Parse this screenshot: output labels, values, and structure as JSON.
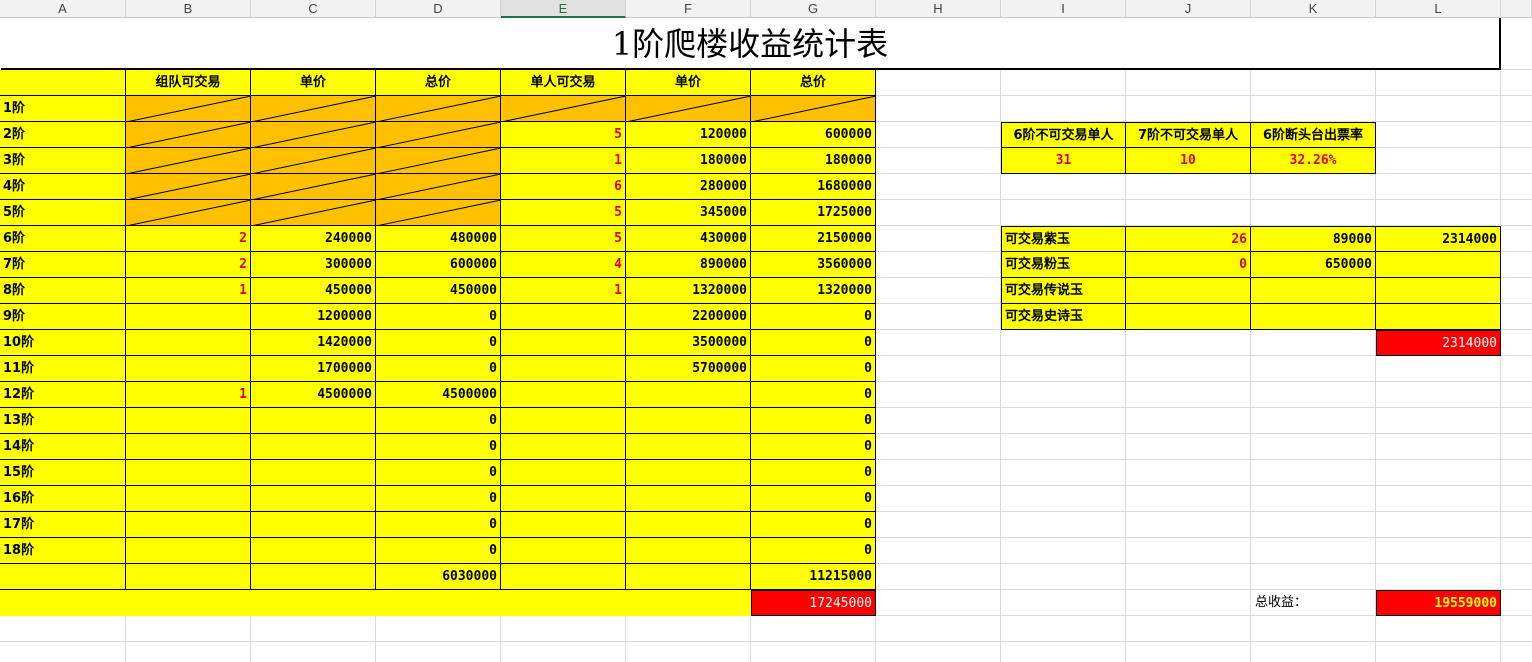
{
  "columns": [
    "A",
    "B",
    "C",
    "D",
    "E",
    "F",
    "G",
    "H",
    "I",
    "J",
    "K",
    "L"
  ],
  "selected_column": "E",
  "title": "1阶爬楼收益统计表",
  "main_table": {
    "headers": [
      "",
      "组队可交易",
      "单价",
      "总价",
      "单人可交易",
      "单价",
      "总价"
    ],
    "rows": [
      {
        "label": "1阶",
        "b": "",
        "c": "",
        "d": "",
        "e": "",
        "f": "",
        "g": "",
        "slashed": [
          1,
          2,
          3,
          4,
          5,
          6
        ]
      },
      {
        "label": "2阶",
        "b": "",
        "c": "",
        "d": "",
        "e": "5",
        "f": "120000",
        "g": "600000",
        "slashed": [
          1,
          2,
          3
        ]
      },
      {
        "label": "3阶",
        "b": "",
        "c": "",
        "d": "",
        "e": "1",
        "f": "180000",
        "g": "180000",
        "slashed": [
          1,
          2,
          3
        ]
      },
      {
        "label": "4阶",
        "b": "",
        "c": "",
        "d": "",
        "e": "6",
        "f": "280000",
        "g": "1680000",
        "slashed": [
          1,
          2,
          3
        ]
      },
      {
        "label": "5阶",
        "b": "",
        "c": "",
        "d": "",
        "e": "5",
        "f": "345000",
        "g": "1725000",
        "slashed": [
          1,
          2,
          3
        ]
      },
      {
        "label": "6阶",
        "b": "2",
        "c": "240000",
        "d": "480000",
        "e": "5",
        "f": "430000",
        "g": "2150000",
        "slashed": []
      },
      {
        "label": "7阶",
        "b": "2",
        "c": "300000",
        "d": "600000",
        "e": "4",
        "f": "890000",
        "g": "3560000",
        "slashed": []
      },
      {
        "label": "8阶",
        "b": "1",
        "c": "450000",
        "d": "450000",
        "e": "1",
        "f": "1320000",
        "g": "1320000",
        "slashed": []
      },
      {
        "label": "9阶",
        "b": "",
        "c": "1200000",
        "d": "0",
        "e": "",
        "f": "2200000",
        "g": "0",
        "slashed": []
      },
      {
        "label": "10阶",
        "b": "",
        "c": "1420000",
        "d": "0",
        "e": "",
        "f": "3500000",
        "g": "0",
        "slashed": []
      },
      {
        "label": "11阶",
        "b": "",
        "c": "1700000",
        "d": "0",
        "e": "",
        "f": "5700000",
        "g": "0",
        "slashed": []
      },
      {
        "label": "12阶",
        "b": "1",
        "c": "4500000",
        "d": "4500000",
        "e": "",
        "f": "",
        "g": "0",
        "slashed": []
      },
      {
        "label": "13阶",
        "b": "",
        "c": "",
        "d": "0",
        "e": "",
        "f": "",
        "g": "0",
        "slashed": []
      },
      {
        "label": "14阶",
        "b": "",
        "c": "",
        "d": "0",
        "e": "",
        "f": "",
        "g": "0",
        "slashed": []
      },
      {
        "label": "15阶",
        "b": "",
        "c": "",
        "d": "0",
        "e": "",
        "f": "",
        "g": "0",
        "slashed": []
      },
      {
        "label": "16阶",
        "b": "",
        "c": "",
        "d": "0",
        "e": "",
        "f": "",
        "g": "0",
        "slashed": []
      },
      {
        "label": "17阶",
        "b": "",
        "c": "",
        "d": "0",
        "e": "",
        "f": "",
        "g": "0",
        "slashed": []
      },
      {
        "label": "18阶",
        "b": "",
        "c": "",
        "d": "0",
        "e": "",
        "f": "",
        "g": "0",
        "slashed": []
      }
    ],
    "sum_team": "6030000",
    "sum_single": "11215000",
    "grand_total": "17245000"
  },
  "ticket_table": {
    "headers": [
      "6阶不可交易单人",
      "7阶不可交易单人",
      "6阶断头台出票率"
    ],
    "values": [
      "31",
      "10",
      "32.26%"
    ]
  },
  "jade_table": {
    "rows": [
      {
        "label": "可交易紫玉",
        "count": "26",
        "price": "89000",
        "total": "2314000"
      },
      {
        "label": "可交易粉玉",
        "count": "0",
        "price": "650000",
        "total": ""
      },
      {
        "label": "可交易传说玉",
        "count": "",
        "price": "",
        "total": ""
      },
      {
        "label": "可交易史诗玉",
        "count": "",
        "price": "",
        "total": ""
      }
    ],
    "sum": "2314000"
  },
  "total_income_label": "总收益：",
  "total_income_value": "19559000",
  "colors": {
    "yellow": "#ffff00",
    "orange": "#ffc000",
    "red": "#ff0000",
    "number_red": "#e0001a"
  }
}
